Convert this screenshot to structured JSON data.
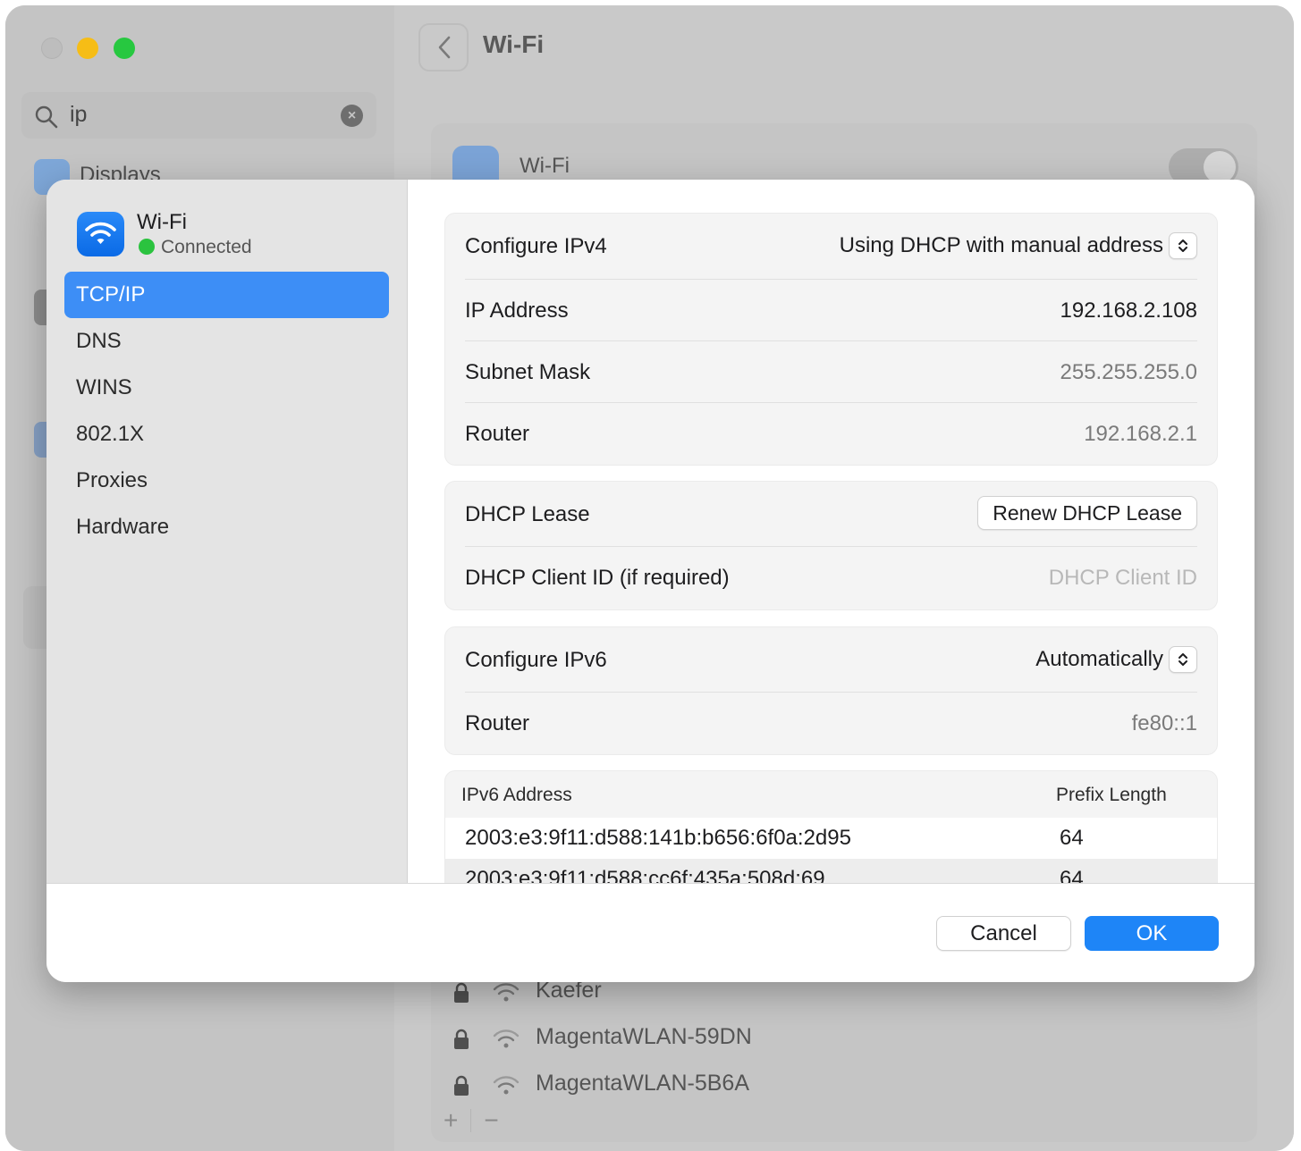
{
  "background_window": {
    "search": {
      "value": "ip"
    },
    "sidebar_visible_item": "Displays",
    "title": "Wi-Fi",
    "wifi_row_label": "Wi-Fi",
    "networks": [
      {
        "name": "Kaefer",
        "icons": [
          "lock-icon",
          "wifi-signal-icon"
        ]
      },
      {
        "name": "MagentaWLAN-59DN",
        "icons": [
          "lock-icon",
          "wifi-signal-icon"
        ]
      },
      {
        "name": "MagentaWLAN-5B6A",
        "icons": [
          "lock-icon",
          "wifi-signal-icon"
        ]
      }
    ],
    "add_symbol": "+",
    "remove_symbol": "−"
  },
  "dialog": {
    "service": {
      "name": "Wi-Fi",
      "status": "Connected",
      "status_color": "#2bc33f"
    },
    "nav": [
      "TCP/IP",
      "DNS",
      "WINS",
      "802.1X",
      "Proxies",
      "Hardware"
    ],
    "selected_nav": "TCP/IP",
    "ipv4": {
      "configure_label": "Configure IPv4",
      "configure_value": "Using DHCP with manual address",
      "ip_label": "IP Address",
      "ip_value": "192.168.2.108",
      "subnet_label": "Subnet Mask",
      "subnet_value": "255.255.255.0",
      "router_label": "Router",
      "router_value": "192.168.2.1"
    },
    "dhcp": {
      "lease_label": "DHCP Lease",
      "renew_button": "Renew DHCP Lease",
      "client_id_label": "DHCP Client ID (if required)",
      "client_id_placeholder": "DHCP Client ID"
    },
    "ipv6": {
      "configure_label": "Configure IPv6",
      "configure_value": "Automatically",
      "router_label": "Router",
      "router_value": "fe80::1"
    },
    "ipv6_table": {
      "headers": [
        "IPv6 Address",
        "Prefix Length"
      ],
      "rows": [
        [
          "2003:e3:9f11:d588:141b:b656:6f0a:2d95",
          "64"
        ],
        [
          "2003:e3:9f11:d588:cc6f:435a:508d:69",
          "64"
        ]
      ]
    },
    "buttons": {
      "cancel": "Cancel",
      "ok": "OK"
    },
    "accent_color": "#1e85f7"
  }
}
